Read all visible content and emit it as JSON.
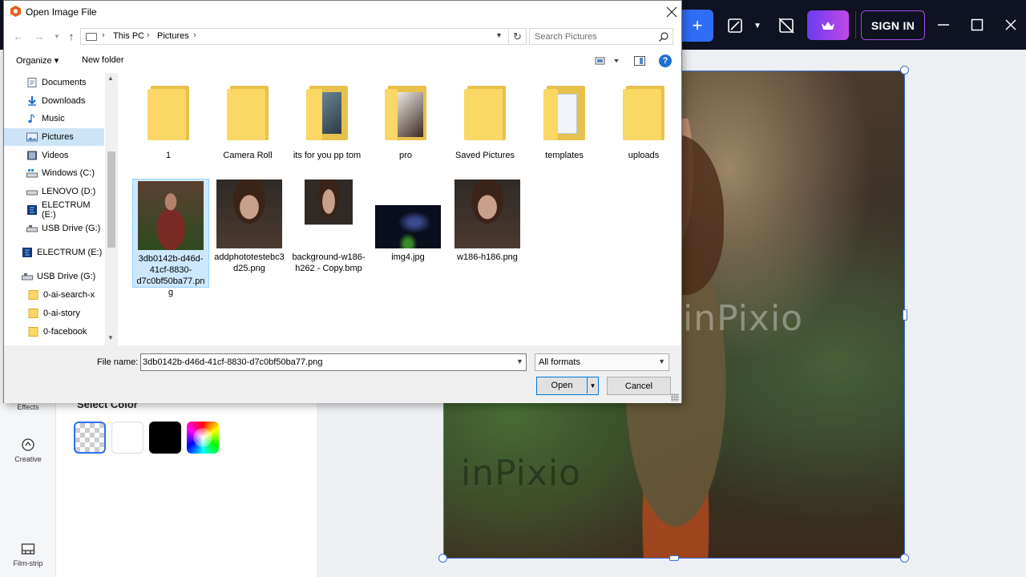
{
  "app": {
    "toolbar": {
      "plus_label": "+",
      "signin_label": "SIGN IN"
    },
    "rail": {
      "items": [
        {
          "label": "Effects",
          "icon": "effects-icon"
        },
        {
          "label": "Creative",
          "icon": "creative-icon"
        },
        {
          "label": "Film-strip",
          "icon": "film-strip-icon"
        }
      ]
    },
    "panel": {
      "select_color_label": "Select Color",
      "swatches": [
        "transparent",
        "#ffffff",
        "#000000",
        "color-wheel"
      ]
    },
    "canvas": {
      "watermark": "inPixio",
      "accent_color": "#3a6fd8"
    },
    "colors": {
      "topbar": "#0f1220",
      "plus_button": "#2f6df6",
      "premium_gradient": [
        "#6a3cf2",
        "#c248e6"
      ]
    }
  },
  "dialog": {
    "title": "Open Image File",
    "address": {
      "crumbs": [
        "This PC",
        "Pictures"
      ]
    },
    "search_placeholder": "Search Pictures",
    "toolbar": {
      "organize_label": "Organize ▾",
      "new_folder_label": "New folder",
      "help_label": "?"
    },
    "nav_items": [
      {
        "label": "Documents",
        "icon": "documents-icon"
      },
      {
        "label": "Downloads",
        "icon": "downloads-icon"
      },
      {
        "label": "Music",
        "icon": "music-icon"
      },
      {
        "label": "Pictures",
        "icon": "pictures-icon",
        "selected": true
      },
      {
        "label": "Videos",
        "icon": "videos-icon"
      },
      {
        "label": "Windows (C:)",
        "icon": "drive-icon"
      },
      {
        "label": "LENOVO (D:)",
        "icon": "drive-icon"
      },
      {
        "label": "ELECTRUM (E:)",
        "icon": "app-drive-icon"
      },
      {
        "label": "USB Drive (G:)",
        "icon": "usb-drive-icon"
      },
      {
        "label": "ELECTRUM (E:)",
        "icon": "app-drive-icon"
      },
      {
        "label": "USB Drive (G:)",
        "icon": "usb-drive-icon"
      },
      {
        "label": "0-ai-search-x",
        "icon": "folder-icon"
      },
      {
        "label": "0-ai-story",
        "icon": "folder-icon"
      },
      {
        "label": "0-facebook",
        "icon": "folder-icon"
      }
    ],
    "folders": [
      {
        "label": "1"
      },
      {
        "label": "Camera Roll"
      },
      {
        "label": "its for you pp tom"
      },
      {
        "label": "pro"
      },
      {
        "label": "Saved Pictures"
      },
      {
        "label": "templates"
      },
      {
        "label": "uploads"
      }
    ],
    "files": [
      {
        "label": "3db0142b-d46d-41cf-8830-d7c0bf50ba77.png",
        "selected": true
      },
      {
        "label": "addphototestebc3d25.png"
      },
      {
        "label": "background-w186-h262 - Copy.bmp"
      },
      {
        "label": "img4.jpg"
      },
      {
        "label": "w186-h186.png"
      }
    ],
    "file_name_label": "File name:",
    "file_name_value": "3db0142b-d46d-41cf-8830-d7c0bf50ba77.png",
    "format_value": "All formats",
    "open_label": "Open",
    "cancel_label": "Cancel"
  }
}
